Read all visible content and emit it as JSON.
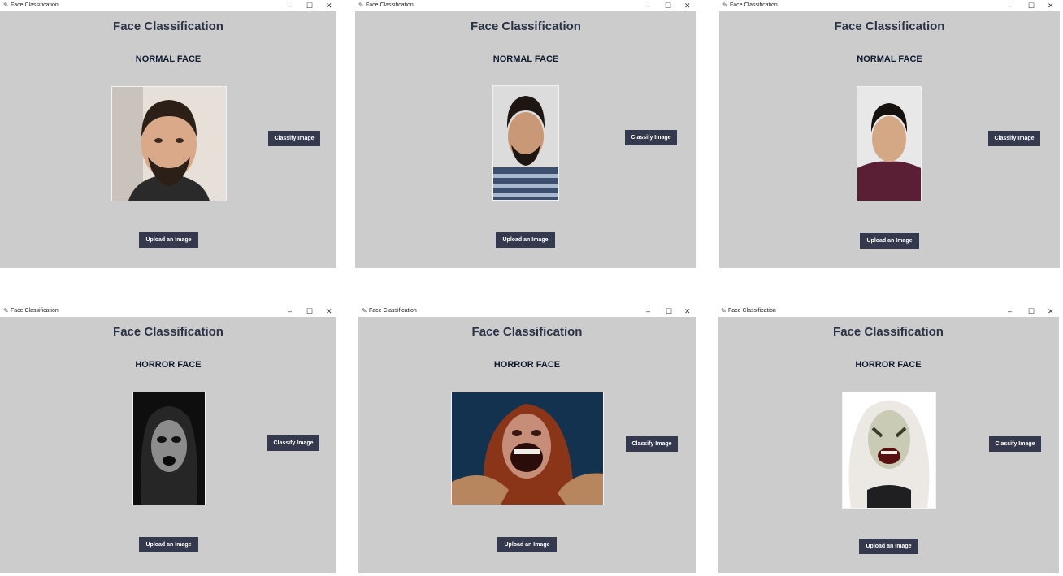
{
  "window_title": "Face Classification",
  "window_controls": {
    "minimize": "–",
    "maximize": "☐",
    "close": "✕"
  },
  "app_title": "Face Classification",
  "classify_label": "Classify Image",
  "upload_label": "Upload an Image",
  "windows": [
    {
      "result": "NORMAL FACE",
      "image": "bearded man with dark hair"
    },
    {
      "result": "NORMAL FACE",
      "image": "man in striped sweater"
    },
    {
      "result": "NORMAL FACE",
      "image": "man in maroon shirt"
    },
    {
      "result": "HORROR FACE",
      "image": "black and white ghost girl"
    },
    {
      "result": "HORROR FACE",
      "image": "screaming red-haired monster"
    },
    {
      "result": "HORROR FACE",
      "image": "white-haired horror mask"
    }
  ]
}
